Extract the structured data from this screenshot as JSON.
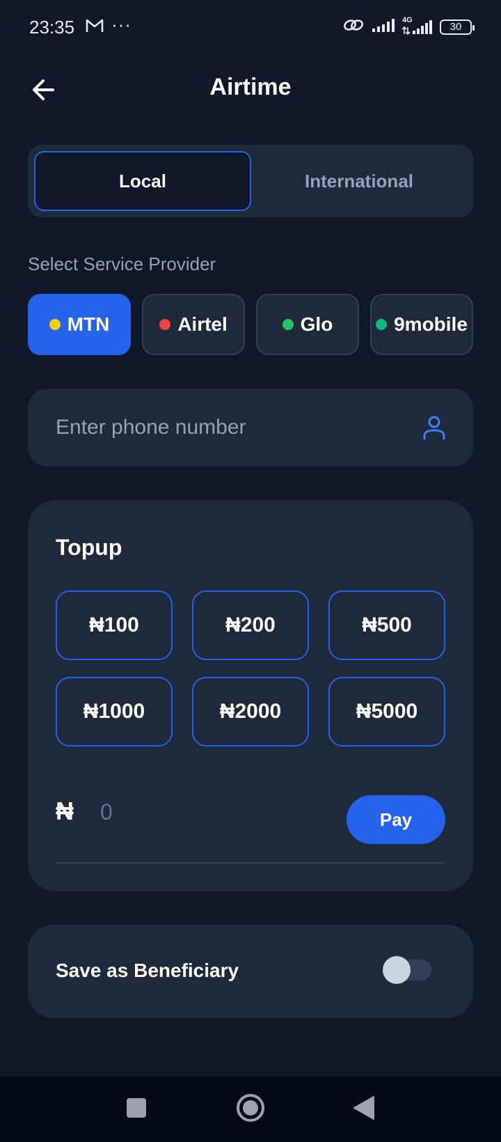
{
  "status_bar": {
    "time": "23:35",
    "more": "···",
    "network": "4G",
    "battery": "30"
  },
  "header": {
    "title": "Airtime"
  },
  "tabs": [
    {
      "label": "Local",
      "active": true
    },
    {
      "label": "International",
      "active": false
    }
  ],
  "provider_section": {
    "label": "Select Service Provider",
    "providers": [
      {
        "name": "MTN",
        "dot_color": "#facc15",
        "active": true
      },
      {
        "name": "Airtel",
        "dot_color": "#ef4444",
        "active": false
      },
      {
        "name": "Glo",
        "dot_color": "#22c55e",
        "active": false
      },
      {
        "name": "9mobile",
        "dot_color": "#10b981",
        "active": false
      }
    ]
  },
  "phone": {
    "placeholder": "Enter phone number",
    "value": ""
  },
  "topup": {
    "title": "Topup",
    "amounts": [
      "₦100",
      "₦200",
      "₦500",
      "₦1000",
      "₦2000",
      "₦5000"
    ],
    "currency_symbol": "₦",
    "amount_placeholder": "0",
    "pay_label": "Pay"
  },
  "beneficiary": {
    "label": "Save as Beneficiary",
    "enabled": false
  },
  "colors": {
    "background": "#0f1729",
    "surface": "#1e293b",
    "accent": "#2563eb",
    "muted_text": "#94a3b8"
  },
  "icons": {
    "back": "arrow-left-icon",
    "contact": "person-icon",
    "nav_recents": "square-icon",
    "nav_home": "circle-icon",
    "nav_back": "triangle-back-icon"
  }
}
